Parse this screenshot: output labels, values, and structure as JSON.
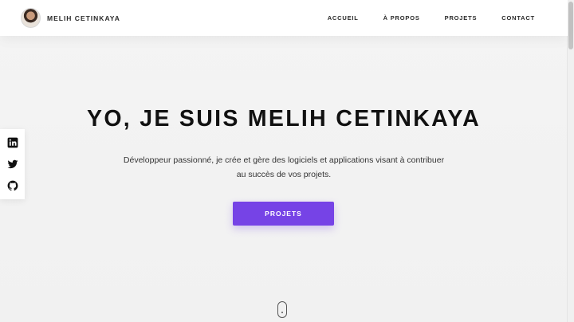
{
  "header": {
    "brand_name": "MELIH CETINKAYA",
    "nav": [
      {
        "label": "ACCUEIL"
      },
      {
        "label": "À PROPOS"
      },
      {
        "label": "PROJETS"
      },
      {
        "label": "CONTACT"
      }
    ]
  },
  "social": [
    {
      "icon": "linkedin-icon"
    },
    {
      "icon": "twitter-icon"
    },
    {
      "icon": "github-icon"
    }
  ],
  "hero": {
    "title": "YO, JE SUIS MELIH CETINKAYA",
    "description_line1": "Développeur passionné, je crée et gère des logiciels et applications visant à contribuer",
    "description_line2": "au succès de vos projets.",
    "cta_label": "PROJETS"
  },
  "colors": {
    "accent": "#7643e6",
    "background": "#f2f2f2",
    "header_bg": "#ffffff",
    "text": "#111111"
  }
}
